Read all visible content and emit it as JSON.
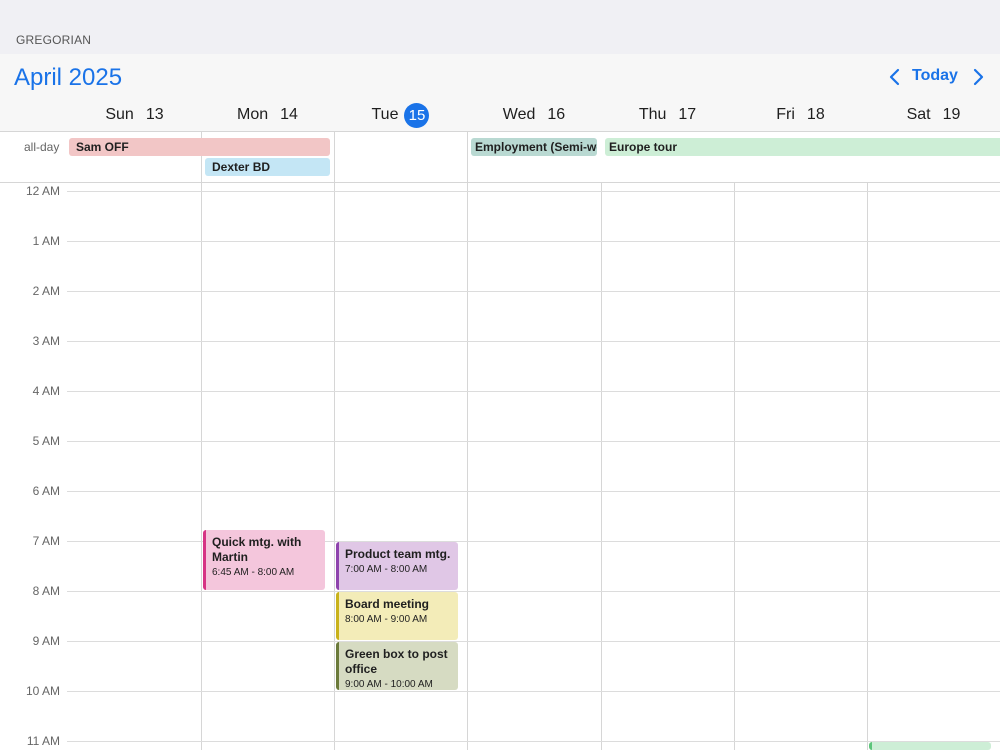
{
  "calendar_system": "GREGORIAN",
  "header": {
    "month_title": "April 2025",
    "today_label": "Today",
    "prev_icon": "chevron-left-icon",
    "next_icon": "chevron-right-icon"
  },
  "colors": {
    "accent": "#1a73e8"
  },
  "days": [
    {
      "name": "Sun",
      "num": "13",
      "is_today": false
    },
    {
      "name": "Mon",
      "num": "14",
      "is_today": false
    },
    {
      "name": "Tue",
      "num": "15",
      "is_today": true
    },
    {
      "name": "Wed",
      "num": "16",
      "is_today": false
    },
    {
      "name": "Thu",
      "num": "17",
      "is_today": false
    },
    {
      "name": "Fri",
      "num": "18",
      "is_today": false
    },
    {
      "name": "Sat",
      "num": "19",
      "is_today": false
    }
  ],
  "all_day_label": "all-day",
  "all_day_events": [
    {
      "title": "Sam OFF",
      "color": "#f2c6c6"
    },
    {
      "title": "Dexter BD",
      "color": "#c4e6f5"
    },
    {
      "title": "Employment (Semi-weekly)",
      "color": "#b9d9d2"
    },
    {
      "title": "Europe tour",
      "color": "#cdeed6"
    }
  ],
  "hours": [
    "12 AM",
    "1 AM",
    "2 AM",
    "3 AM",
    "4 AM",
    "5 AM",
    "6 AM",
    "7 AM",
    "8 AM",
    "9 AM",
    "10 AM",
    "11 AM"
  ],
  "events": [
    {
      "title": "Quick mtg. with Martin",
      "time": "6:45 AM - 8:00 AM",
      "color": "#f4c6dc",
      "accent": "#d63384"
    },
    {
      "title": "Product team mtg.",
      "time": "7:00 AM - 8:00 AM",
      "color": "#e0c7e6",
      "accent": "#8e44ad"
    },
    {
      "title": "Board meeting",
      "time": "8:00 AM - 9:00 AM",
      "color": "#f3ecb8",
      "accent": "#c9b21a"
    },
    {
      "title": "Green box to post office",
      "time": "9:00 AM - 10:00 AM",
      "color": "#d6dbc2",
      "accent": "#6b7a3a"
    },
    {
      "title": "",
      "time": "",
      "color": "#cdeed6",
      "accent": "#5cc47a"
    }
  ]
}
